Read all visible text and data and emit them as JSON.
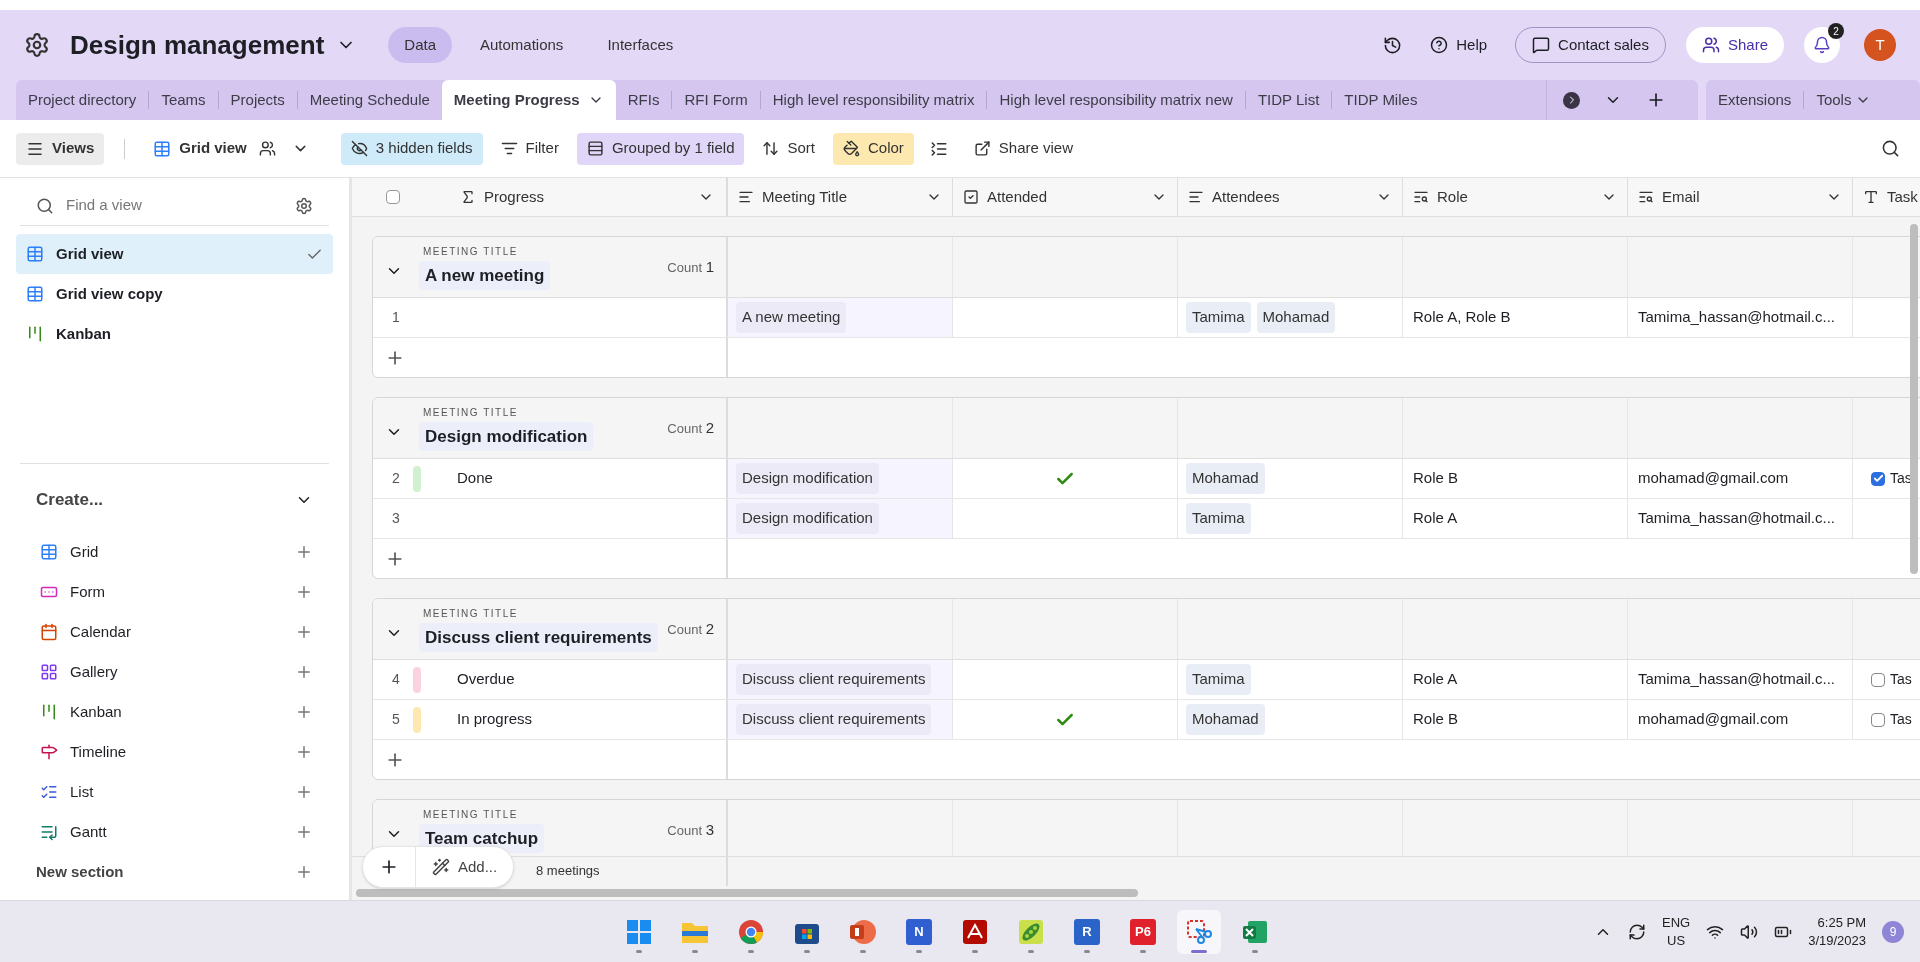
{
  "base": {
    "title": "Design management",
    "nav": [
      {
        "label": "Data",
        "selected": true
      },
      {
        "label": "Automations",
        "selected": false
      },
      {
        "label": "Interfaces",
        "selected": false
      }
    ]
  },
  "header_actions": {
    "help": "Help",
    "contact": "Contact sales",
    "share": "Share",
    "notifications": "2",
    "avatar": "T"
  },
  "tabs": [
    {
      "label": "Project directory",
      "selected": false
    },
    {
      "label": "Teams",
      "selected": false
    },
    {
      "label": "Projects",
      "selected": false
    },
    {
      "label": "Meeting Schedule",
      "selected": false
    },
    {
      "label": "Meeting Progress",
      "selected": true
    },
    {
      "label": "RFIs",
      "selected": false
    },
    {
      "label": "RFI Form",
      "selected": false
    },
    {
      "label": "High level responsibility matrix",
      "selected": false
    },
    {
      "label": "High level responsibility matrix new",
      "selected": false
    },
    {
      "label": "TIDP List",
      "selected": false
    },
    {
      "label": "TIDP Miles",
      "selected": false
    }
  ],
  "tab_extras": {
    "extensions": "Extensions",
    "tools": "Tools"
  },
  "toolbar": {
    "views": "Views",
    "view_name": "Grid view",
    "hidden": "3 hidden fields",
    "filter": "Filter",
    "group": "Grouped by 1 field",
    "sort": "Sort",
    "color_label": "Color",
    "share_view": "Share view"
  },
  "sidebar": {
    "search_placeholder": "Find a view",
    "views": [
      {
        "label": "Grid view",
        "kind": "grid",
        "selected": true
      },
      {
        "label": "Grid view copy",
        "kind": "grid",
        "selected": false
      },
      {
        "label": "Kanban",
        "kind": "kanban",
        "selected": false
      }
    ],
    "create_title": "Create...",
    "create_items": [
      {
        "label": "Grid",
        "kind": "grid"
      },
      {
        "label": "Form",
        "kind": "form"
      },
      {
        "label": "Calendar",
        "kind": "calendar"
      },
      {
        "label": "Gallery",
        "kind": "gallery"
      },
      {
        "label": "Kanban",
        "kind": "kanban"
      },
      {
        "label": "Timeline",
        "kind": "timeline"
      },
      {
        "label": "List",
        "kind": "list"
      },
      {
        "label": "Gantt",
        "kind": "gantt"
      }
    ],
    "new_section": "New section"
  },
  "table": {
    "columns": [
      {
        "label": "Progress",
        "kind": "formula"
      },
      {
        "label": "Meeting Title",
        "kind": "link"
      },
      {
        "label": "Attended",
        "kind": "checkbox"
      },
      {
        "label": "Attendees",
        "kind": "link"
      },
      {
        "label": "Role",
        "kind": "lookup"
      },
      {
        "label": "Email",
        "kind": "lookup"
      },
      {
        "label": "Task",
        "kind": "text"
      }
    ],
    "groups": [
      {
        "caption": "MEETING TITLE",
        "title": "A new meeting",
        "count_label": "Count",
        "count": "1",
        "rows": [
          {
            "number": "1",
            "meeting_title": "A new meeting",
            "attended": false,
            "attendees": [
              "Tamima",
              "Mohamad"
            ],
            "role": "Role A, Role B",
            "email": "Tamima_hassan@hotmail.c..."
          }
        ]
      },
      {
        "caption": "MEETING TITLE",
        "title": "Design modification",
        "count_label": "Count",
        "count": "2",
        "rows": [
          {
            "number": "2",
            "progress": "Done",
            "color": "#d1f0cf",
            "meeting_title": "Design modification",
            "attended": true,
            "attendees": [
              "Mohamad"
            ],
            "role": "Role B",
            "email": "mohamad@gmail.com",
            "task": {
              "checked": true,
              "text": "Tas"
            }
          },
          {
            "number": "3",
            "meeting_title": "Design modification",
            "attended": false,
            "attendees": [
              "Tamima"
            ],
            "role": "Role A",
            "email": "Tamima_hassan@hotmail.c..."
          }
        ]
      },
      {
        "caption": "MEETING TITLE",
        "title": "Discuss client requirements",
        "count_label": "Count",
        "count": "2",
        "rows": [
          {
            "number": "4",
            "progress": "Overdue",
            "color": "#fbd3e0",
            "meeting_title": "Discuss client requirements",
            "attended": false,
            "attendees": [
              "Tamima"
            ],
            "role": "Role A",
            "email": "Tamima_hassan@hotmail.c...",
            "task": {
              "checked": false,
              "text": "Tas"
            }
          },
          {
            "number": "5",
            "progress": "In progress",
            "color": "#fde8b0",
            "meeting_title": "Discuss client requirements",
            "attended": true,
            "attendees": [
              "Mohamad"
            ],
            "role": "Role B",
            "email": "mohamad@gmail.com",
            "task": {
              "checked": false,
              "text": "Tas"
            }
          }
        ]
      },
      {
        "caption": "MEETING TITLE",
        "title": "Team catchup",
        "count_label": "Count",
        "count": "3"
      }
    ],
    "select_all_checked": false
  },
  "footer": {
    "add": "Add...",
    "summary": "8 meetings"
  },
  "taskbar": {
    "apps": [
      {
        "kind": "start",
        "selected": false
      },
      {
        "kind": "explorer",
        "selected": false
      },
      {
        "kind": "chrome",
        "selected": false
      },
      {
        "kind": "store",
        "selected": false
      },
      {
        "kind": "powerpoint",
        "selected": false
      },
      {
        "kind": "tile",
        "label": "N",
        "color": "#2f5fd0",
        "selected": false
      },
      {
        "kind": "acrobat",
        "selected": false
      },
      {
        "kind": "peas",
        "selected": false
      },
      {
        "kind": "tile",
        "label": "R",
        "color": "#2a64c8",
        "selected": false
      },
      {
        "kind": "tile",
        "label": "P6",
        "color": "#e0202a",
        "selected": false
      },
      {
        "kind": "snip",
        "selected": true
      },
      {
        "kind": "excel",
        "selected": false
      }
    ],
    "lang": "ENG",
    "region": "US",
    "time": "6:25 PM",
    "date": "3/19/2023",
    "badge": "9"
  }
}
